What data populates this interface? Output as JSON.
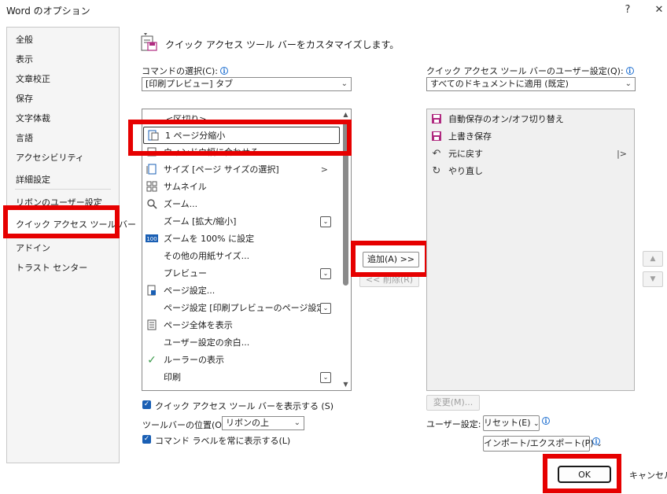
{
  "window": {
    "title": "Word のオプション",
    "help": "?",
    "close": "✕"
  },
  "nav": {
    "items": [
      "全般",
      "表示",
      "文章校正",
      "保存",
      "文字体裁",
      "言語",
      "アクセシビリティ",
      "詳細設定",
      "リボンのユーザー設定",
      "クイック アクセス ツール バー",
      "アドイン",
      "トラスト センター"
    ],
    "selected_index": 9
  },
  "header": {
    "title": "クイック アクセス ツール バーをカスタマイズします。"
  },
  "commands": {
    "label": "コマンドの選択(C):",
    "label_underline": "C",
    "selected": "[印刷プレビュー] タブ",
    "items": [
      {
        "icon": "",
        "label": "<区切り>"
      },
      {
        "icon": "one-page-icon",
        "label": "1 ページ分縮小"
      },
      {
        "icon": "fit-icon",
        "label": "ウィンドウ幅に合わせる"
      },
      {
        "icon": "page-size-icon",
        "label": "サイズ [ページ サイズの選択]",
        "submenu": ">"
      },
      {
        "icon": "thumbnail-icon",
        "label": "サムネイル"
      },
      {
        "icon": "zoom-icon",
        "label": "ズーム..."
      },
      {
        "icon": "",
        "label": "ズーム [拡大/縮小]",
        "dropdown": true
      },
      {
        "icon": "zoom100-icon",
        "label": "ズームを 100% に設定"
      },
      {
        "icon": "",
        "label": "その他の用紙サイズ..."
      },
      {
        "icon": "",
        "label": "プレビュー",
        "dropdown": true
      },
      {
        "icon": "page-setup-icon",
        "label": "ページ設定..."
      },
      {
        "icon": "",
        "label": "ページ設定 [印刷プレビューのページ設定]",
        "dropdown": true
      },
      {
        "icon": "whole-page-icon",
        "label": "ページ全体を表示"
      },
      {
        "icon": "",
        "label": "ユーザー設定の余白..."
      },
      {
        "icon": "check-icon",
        "label": "ルーラーの表示"
      },
      {
        "icon": "",
        "label": "印刷",
        "dropdown": true
      }
    ]
  },
  "qat": {
    "label": "クイック アクセス ツール バーのユーザー設定(Q):",
    "selected": "すべてのドキュメントに適用 (既定)",
    "items": [
      {
        "icon": "autosave-icon",
        "label": "自動保存のオン/オフ切り替え"
      },
      {
        "icon": "save-icon",
        "label": "上書き保存"
      },
      {
        "icon": "undo-icon",
        "label": "元に戻す",
        "submenu": "|>"
      },
      {
        "icon": "redo-icon",
        "label": "やり直し"
      }
    ]
  },
  "buttons": {
    "add": "追加(A) >>",
    "remove": "<< 削除(R)",
    "modify": "変更(M)...",
    "reset": "リセット(E)",
    "import_export": "インポート/エクスポート(P)",
    "ok": "OK",
    "cancel": "キャンセル"
  },
  "options": {
    "show_qat": "クイック アクセス ツール バーを表示する (S)",
    "toolbar_position_label": "ツールバーの位置(O)",
    "toolbar_position_value": "リボンの上",
    "always_show_labels": "コマンド ラベルを常に表示する(L)",
    "user_settings_label": "ユーザー設定:"
  },
  "colors": {
    "highlight": "#e60000",
    "accent": "#1a5fb4",
    "icon_magenta": "#b02a80"
  }
}
